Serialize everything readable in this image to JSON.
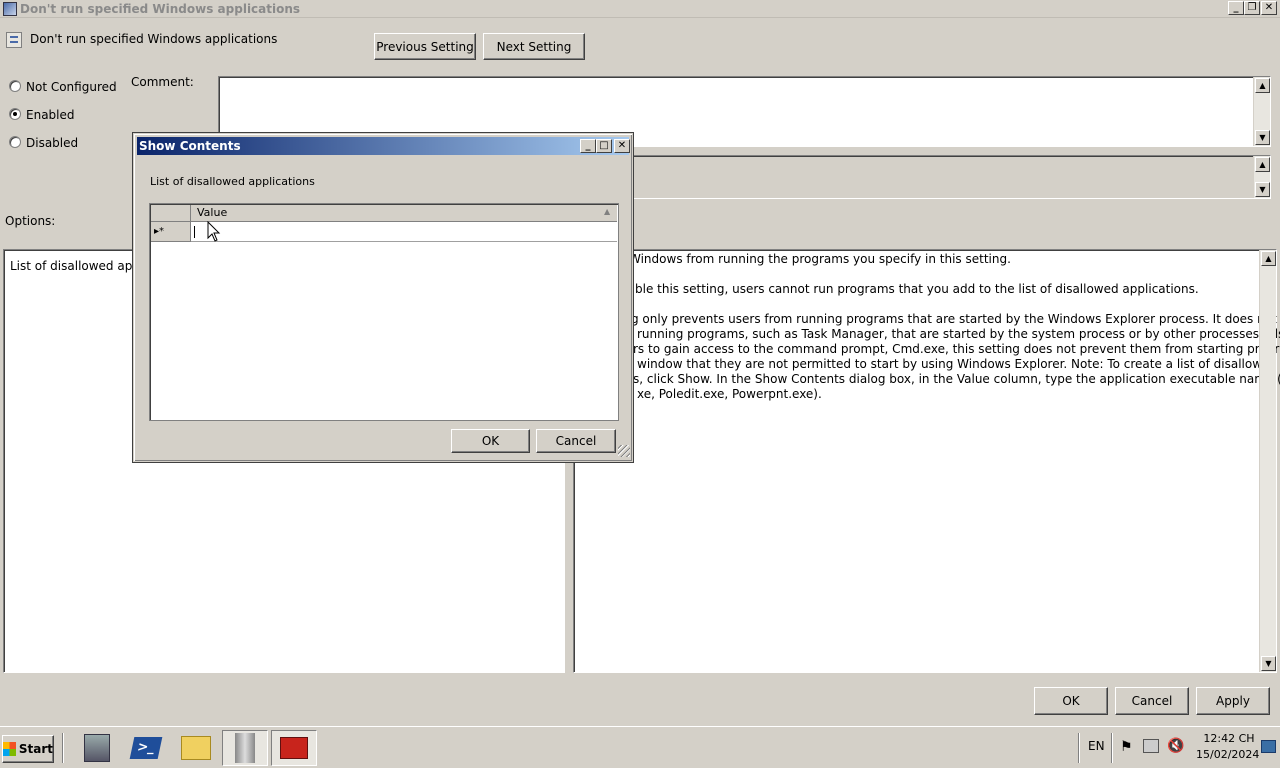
{
  "window": {
    "title": "Don't run specified Windows applications",
    "minimize": "_",
    "restore": "❐",
    "close": "✕"
  },
  "header": {
    "policy_name": "Don't run specified Windows applications",
    "previous_label": "Previous Setting",
    "next_label": "Next Setting"
  },
  "state": {
    "options": [
      {
        "label": "Not Configured",
        "selected": false
      },
      {
        "label": "Enabled",
        "selected": true
      },
      {
        "label": "Disabled",
        "selected": false
      }
    ]
  },
  "comment_label": "Comment:",
  "options_label": "Options:",
  "options_panel": {
    "item_label": "List of disallowed applic"
  },
  "help_text": {
    "lines": [
      "Windows from running the programs you specify in this setting.",
      "ble this setting, users cannot run programs that you add to the list of disallowed applications.",
      "g only prevents users from running programs that are started by the Windows Explorer process. It does not prevent",
      "running programs, such as Task Manager, that are started by the system process or by other processes. Also, if you",
      "rs to gain access to the command prompt, Cmd.exe, this setting does not prevent them from starting programs in the",
      "window that they are not permitted to start by using Windows Explorer. Note: To create a list of disallowed",
      "s, click Show. In the Show Contents dialog box, in the Value column, type the application executable name (e.g.,",
      "xe, Poledit.exe, Powerpnt.exe)."
    ]
  },
  "footer": {
    "ok_label": "OK",
    "cancel_label": "Cancel",
    "apply_label": "Apply"
  },
  "dialog": {
    "title": "Show Contents",
    "list_label": "List of disallowed applications",
    "column_header": "Value",
    "row_marker": "▸*",
    "cell_value": "",
    "ok_label": "OK",
    "cancel_label": "Cancel"
  },
  "taskbar": {
    "start_label": "Start",
    "items": [
      "server-manager-icon",
      "powershell-icon",
      "explorer-icon",
      "tools-icon",
      "toolbox-icon"
    ],
    "language": "EN",
    "time": "12:42 CH",
    "date": "15/02/2024"
  }
}
